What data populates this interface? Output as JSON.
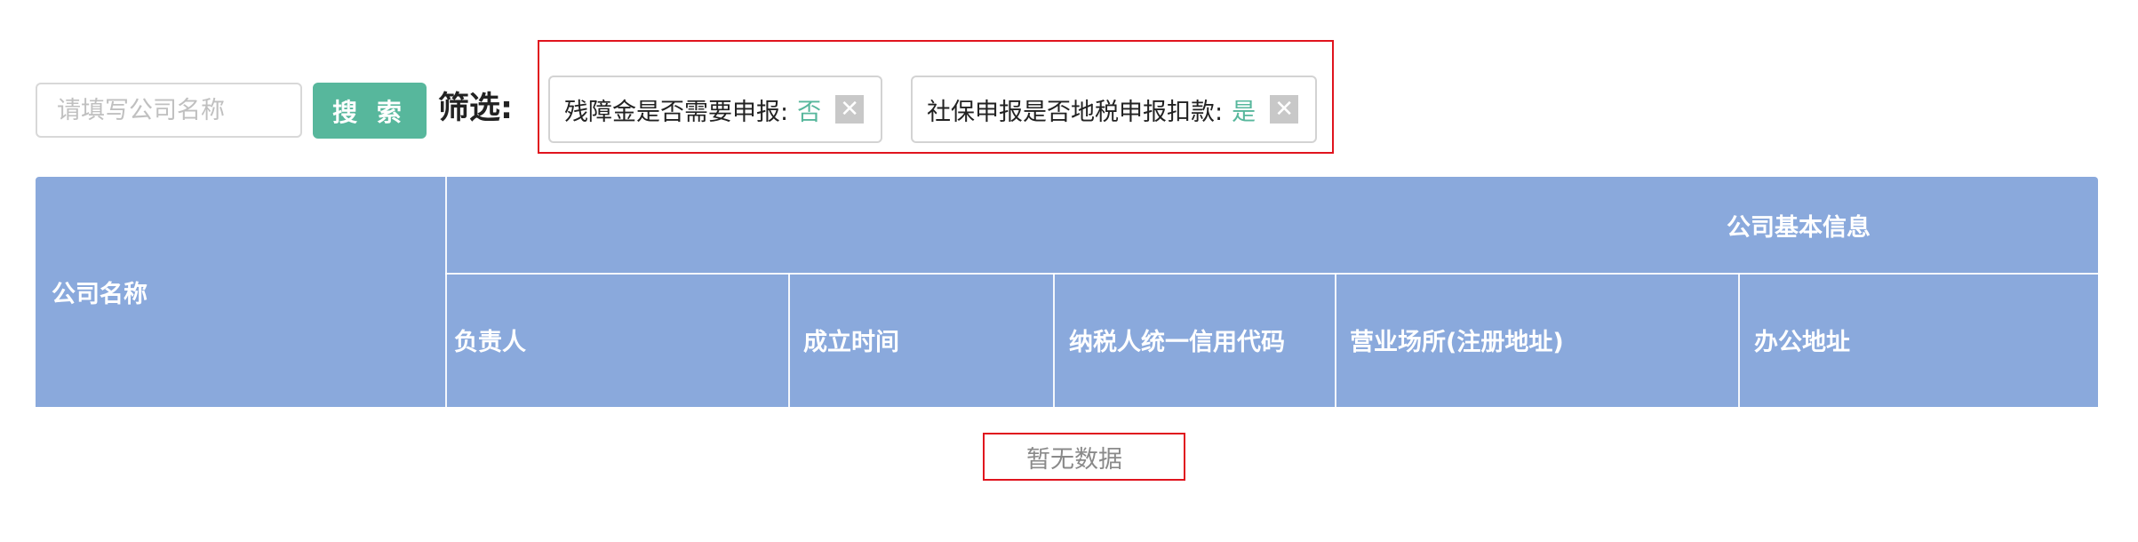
{
  "search": {
    "placeholder": "请填写公司名称",
    "button_label": "搜 索"
  },
  "filter": {
    "label": "筛选:",
    "tags": [
      {
        "name": "残障金是否需要申报:",
        "value": "否",
        "close": "✕"
      },
      {
        "name": "社保申报是否地税申报扣款:",
        "value": "是",
        "close": "✕"
      }
    ]
  },
  "table": {
    "company_name_header": "公司名称",
    "group_header": "公司基本信息",
    "columns": [
      "负责人",
      "成立时间",
      "纳税人统一信用代码",
      "营业场所(注册地址)",
      "办公地址"
    ],
    "empty_text": "暂无数据"
  },
  "colors": {
    "header_bg": "#8aa9dc",
    "accent": "#57b79c",
    "highlight": "#e0141e"
  }
}
